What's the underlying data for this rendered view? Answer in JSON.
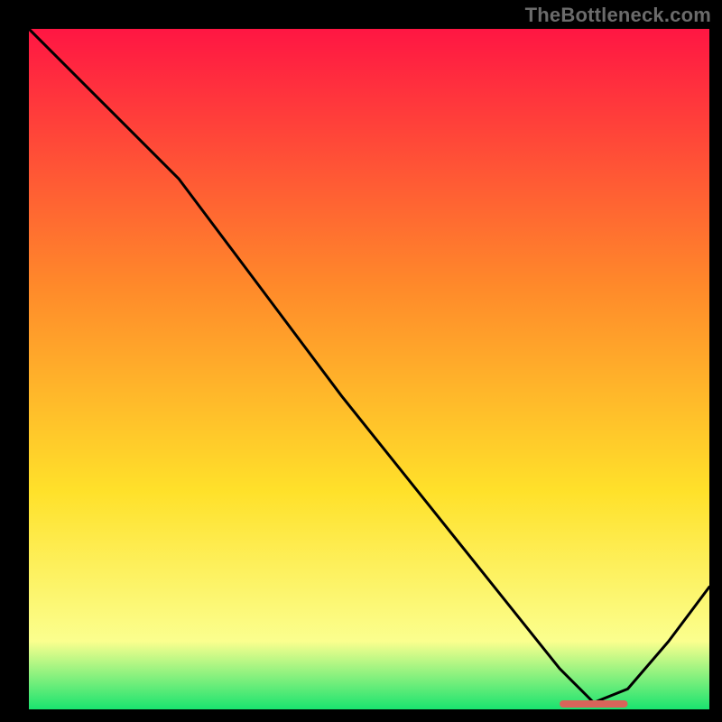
{
  "watermark": "TheBottleneck.com",
  "colors": {
    "bg": "#000000",
    "gradient_top": "#ff1643",
    "gradient_mid1": "#ff8a2a",
    "gradient_mid2": "#ffe12a",
    "gradient_mid3": "#fbff8e",
    "gradient_bottom": "#19e36f",
    "line": "#000000",
    "marker": "#d9645a"
  },
  "chart_data": {
    "type": "line",
    "title": "",
    "xlabel": "",
    "ylabel": "",
    "xlim": [
      0,
      100
    ],
    "ylim": [
      0,
      100
    ],
    "series": [
      {
        "name": "curve",
        "x": [
          0,
          10,
          22,
          34,
          46,
          58,
          70,
          78,
          83,
          88,
          94,
          100
        ],
        "y": [
          100,
          90,
          78,
          62,
          46,
          31,
          16,
          6,
          1,
          3,
          10,
          18
        ]
      }
    ],
    "optimal_range_x": [
      78,
      88
    ],
    "optimal_y": 0.8
  }
}
